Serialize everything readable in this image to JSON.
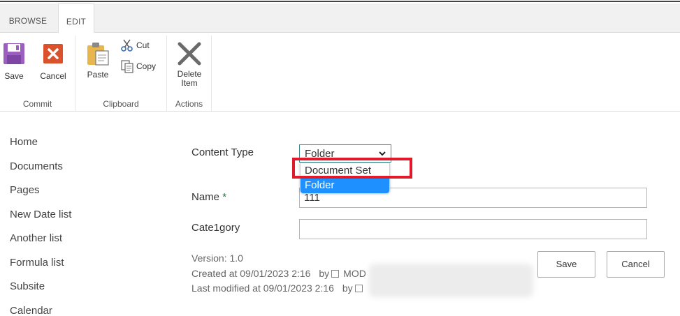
{
  "tabs": {
    "browse": "BROWSE",
    "edit": "EDIT"
  },
  "ribbon": {
    "commit": {
      "label": "Commit",
      "save": "Save",
      "cancel": "Cancel"
    },
    "clipboard": {
      "label": "Clipboard",
      "paste": "Paste",
      "cut": "Cut",
      "copy": "Copy"
    },
    "actions": {
      "label": "Actions",
      "delete_line1": "Delete",
      "delete_line2": "Item"
    }
  },
  "nav": {
    "items": [
      "Home",
      "Documents",
      "Pages",
      "New Date list",
      "Another list",
      "Formula list",
      "Subsite",
      "Calendar"
    ]
  },
  "form": {
    "content_type_label": "Content Type",
    "content_type_value": "Folder",
    "dropdown_options": [
      "Document Set",
      "Folder"
    ],
    "name_label": "Name",
    "required_marker": "*",
    "name_value": "111",
    "category_label": "Cate1gory",
    "category_value": "",
    "version": "Version: 1.0",
    "created": "Created at 09/01/2023 2:16",
    "created_by": "by",
    "created_user": "MOD",
    "modified": "Last modified at 09/01/2023 2:16",
    "modified_by": "by",
    "save_button": "Save",
    "cancel_button": "Cancel"
  },
  "icons": {
    "save": "save-disk-icon",
    "cancel": "cancel-x-icon",
    "paste": "paste-clipboard-icon",
    "cut": "scissors-icon",
    "copy": "copy-icon",
    "delete": "delete-x-icon"
  },
  "colors": {
    "save_icon": "#9b5fc0",
    "cancel_icon": "#d9522c",
    "highlight_option": "#1e90ff",
    "annotation_box": "#e01a2a",
    "required_star": "#107c41"
  }
}
